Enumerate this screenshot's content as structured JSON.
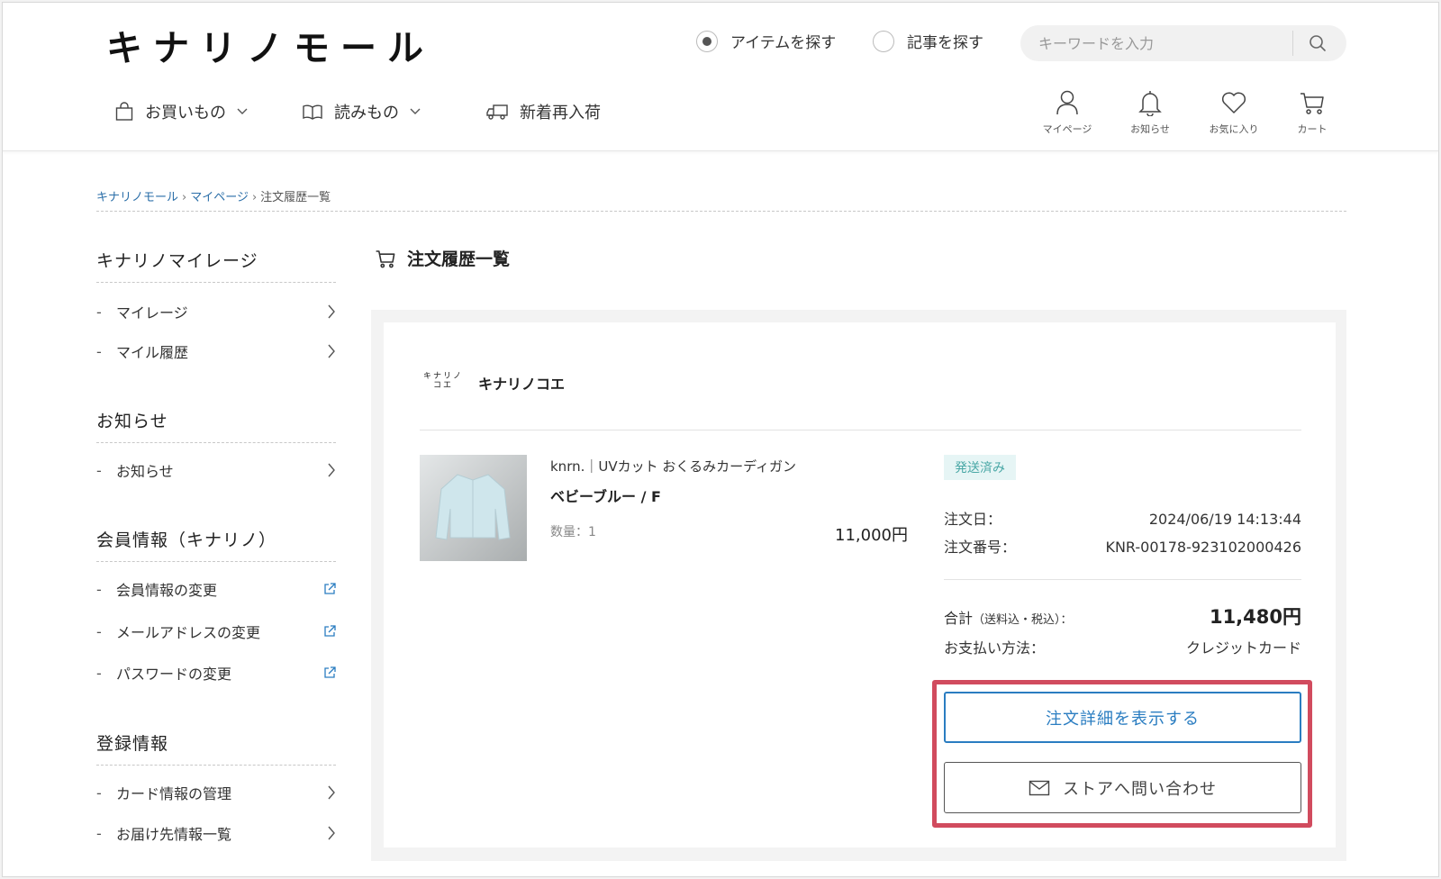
{
  "header": {
    "logo": "キナリノモール",
    "search_modes": [
      {
        "label": "アイテムを探す",
        "checked": true
      },
      {
        "label": "記事を探す",
        "checked": false
      }
    ],
    "search_placeholder": "キーワードを入力",
    "nav": [
      {
        "label": "お買いもの",
        "icon": "shopping-bag-icon",
        "has_dropdown": true
      },
      {
        "label": "読みもの",
        "icon": "book-icon",
        "has_dropdown": true
      },
      {
        "label": "新着再入荷",
        "icon": "truck-icon",
        "has_dropdown": false
      }
    ],
    "icons": [
      {
        "label": "マイページ",
        "icon": "user-icon"
      },
      {
        "label": "お知らせ",
        "icon": "bell-icon"
      },
      {
        "label": "お気に入り",
        "icon": "heart-icon"
      },
      {
        "label": "カート",
        "icon": "cart-icon"
      }
    ]
  },
  "breadcrumb": [
    {
      "label": "キナリノモール",
      "link": true
    },
    {
      "label": "マイページ",
      "link": true
    },
    {
      "label": "注文履歴一覧",
      "link": false
    }
  ],
  "sidebar": {
    "sections": [
      {
        "title": "キナリノマイレージ",
        "items": [
          {
            "label": "マイレージ",
            "icon": "chevron-right-icon"
          },
          {
            "label": "マイル履歴",
            "icon": "chevron-right-icon"
          }
        ]
      },
      {
        "title": "お知らせ",
        "items": [
          {
            "label": "お知らせ",
            "icon": "chevron-right-icon"
          }
        ]
      },
      {
        "title": "会員情報（キナリノ）",
        "items": [
          {
            "label": "会員情報の変更",
            "icon": "external-link-icon"
          },
          {
            "label": "メールアドレスの変更",
            "icon": "external-link-icon"
          },
          {
            "label": "パスワードの変更",
            "icon": "external-link-icon"
          }
        ]
      },
      {
        "title": "登録情報",
        "items": [
          {
            "label": "カード情報の管理",
            "icon": "chevron-right-icon"
          },
          {
            "label": "お届け先情報一覧",
            "icon": "chevron-right-icon"
          }
        ]
      }
    ],
    "item_prefix": "-"
  },
  "main": {
    "title": "注文履歴一覧",
    "order": {
      "store_logo_line1": "キナリノ",
      "store_logo_line2": "コエ",
      "store_name": "キナリノコエ",
      "product_name": "knrn.｜UVカット おくるみカーディガン",
      "variant": "ベビーブルー / F",
      "quantity": "数量：1",
      "price": "11,000円",
      "status": "発送済み",
      "order_date_label": "注文日：",
      "order_date": "2024/06/19 14:13:44",
      "order_number_label": "注文番号：",
      "order_number": "KNR-00178-923102000426",
      "total_label": "合計",
      "total_note": "（送料込・税込）：",
      "total": "11,480円",
      "payment_label": "お支払い方法：",
      "payment": "クレジットカード",
      "detail_button": "注文詳細を表示する",
      "contact_button": "ストアへ問い合わせ"
    }
  },
  "colors": {
    "link": "#2a6ea8",
    "primary": "#2a7dc1",
    "highlight": "#d14b5e",
    "badge_bg": "#e6f5f5",
    "badge_text": "#4aa8a6"
  }
}
